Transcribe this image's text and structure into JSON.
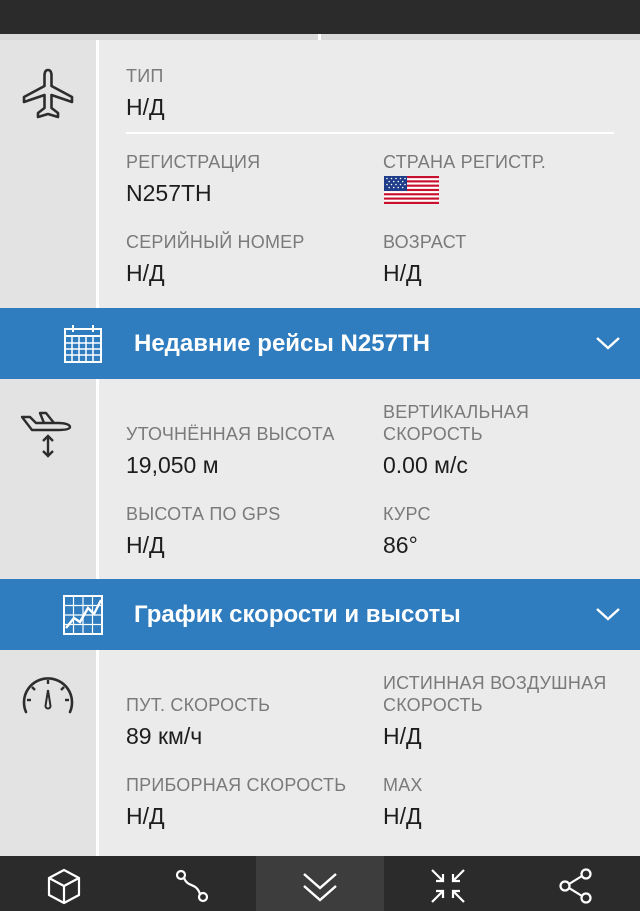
{
  "aircraft": {
    "type_label": "ТИП",
    "type_value": "Н/Д",
    "registration_label": "РЕГИСТРАЦИЯ",
    "registration_value": "N257TH",
    "country_label": "СТРАНА РЕГИСТР.",
    "country_flag": "us-flag-icon",
    "serial_label": "СЕРИЙНЫЙ НОМЕР",
    "serial_value": "Н/Д",
    "age_label": "ВОЗРАСТ",
    "age_value": "Н/Д"
  },
  "recent_flights_bar": {
    "title": "Недавние рейсы N257TH",
    "icon": "calendar-icon"
  },
  "altitude": {
    "calibrated_label": "УТОЧНЁННАЯ ВЫСОТА",
    "calibrated_value": "19,050 м",
    "vspeed_label_line1": "ВЕРТИКАЛЬНАЯ",
    "vspeed_label_line2": "СКОРОСТЬ",
    "vspeed_value": "0.00 м/с",
    "gps_label": "ВЫСОТА ПО GPS",
    "gps_value": "Н/Д",
    "track_label": "КУРС",
    "track_value": "86°"
  },
  "speed_chart_bar": {
    "title": "График скорости и высоты",
    "icon": "chart-icon"
  },
  "speed": {
    "ground_label": "ПУТ. СКОРОСТЬ",
    "ground_value": "89 км/ч",
    "tas_label_line1": "ИСТИННАЯ ВОЗДУШНАЯ",
    "tas_label_line2": "СКОРОСТЬ",
    "tas_value": "Н/Д",
    "ias_label": "ПРИБОРНАЯ СКОРОСТЬ",
    "ias_value": "Н/Д",
    "max_label": "MAX",
    "max_value": "Н/Д"
  },
  "bottom_nav": [
    {
      "icon": "cube-3d-icon"
    },
    {
      "icon": "route-icon"
    },
    {
      "icon": "collapse-chevron-icon"
    },
    {
      "icon": "center-arrows-icon"
    },
    {
      "icon": "share-icon"
    }
  ],
  "colors": {
    "accent_bar": "#2f7dbf",
    "dark_bar": "#2b2b2b",
    "background": "#ebebeb"
  }
}
